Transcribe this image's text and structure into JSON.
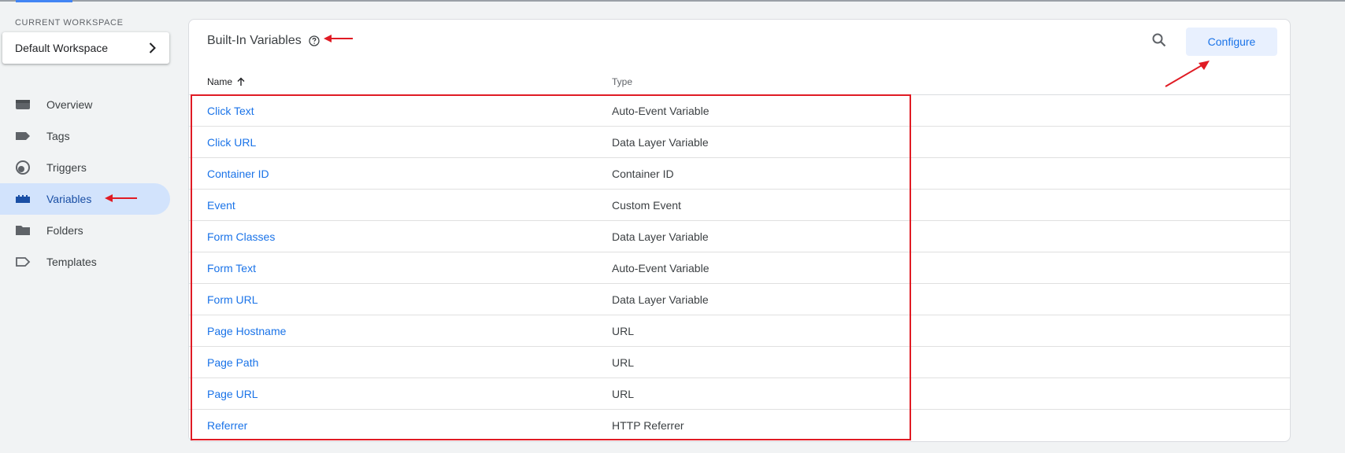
{
  "sidebar": {
    "workspace_label": "CURRENT WORKSPACE",
    "workspace_name": "Default Workspace",
    "items": [
      {
        "label": "Overview",
        "icon": "overview-icon",
        "active": false
      },
      {
        "label": "Tags",
        "icon": "tag-icon",
        "active": false
      },
      {
        "label": "Triggers",
        "icon": "trigger-icon",
        "active": false
      },
      {
        "label": "Variables",
        "icon": "variables-icon",
        "active": true
      },
      {
        "label": "Folders",
        "icon": "folder-icon",
        "active": false
      },
      {
        "label": "Templates",
        "icon": "template-icon",
        "active": false
      }
    ]
  },
  "main": {
    "title": "Built-In Variables",
    "configure_label": "Configure",
    "columns": {
      "name": "Name",
      "type": "Type"
    },
    "rows": [
      {
        "name": "Click Text",
        "type": "Auto-Event Variable"
      },
      {
        "name": "Click URL",
        "type": "Data Layer Variable"
      },
      {
        "name": "Container ID",
        "type": "Container ID"
      },
      {
        "name": "Event",
        "type": "Custom Event"
      },
      {
        "name": "Form Classes",
        "type": "Data Layer Variable"
      },
      {
        "name": "Form Text",
        "type": "Auto-Event Variable"
      },
      {
        "name": "Form URL",
        "type": "Data Layer Variable"
      },
      {
        "name": "Page Hostname",
        "type": "URL"
      },
      {
        "name": "Page Path",
        "type": "URL"
      },
      {
        "name": "Page URL",
        "type": "URL"
      },
      {
        "name": "Referrer",
        "type": "HTTP Referrer"
      }
    ]
  },
  "colors": {
    "accent": "#1a73e8",
    "active_nav_bg": "#d2e3fc",
    "annotation": "#e01b24"
  }
}
